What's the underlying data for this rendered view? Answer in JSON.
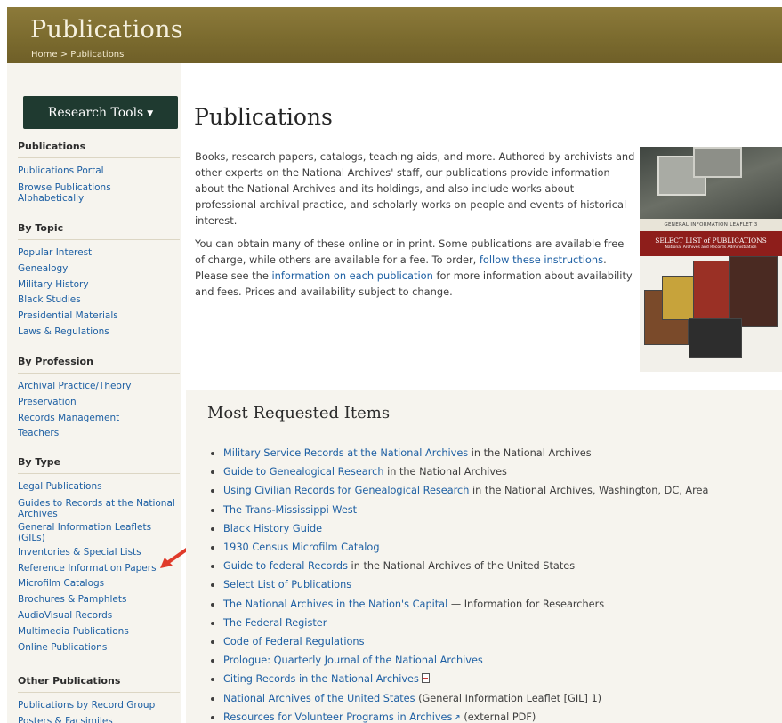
{
  "banner": {
    "title": "Publications",
    "breadcrumb": "Home > Publications"
  },
  "sidebar": {
    "research_tools_label": "Research Tools",
    "sections": {
      "publications": {
        "heading": "Publications",
        "items": [
          "Publications Portal",
          "Browse Publications Alphabetically"
        ]
      },
      "by_topic": {
        "heading": "By Topic",
        "items": [
          "Popular Interest",
          "Genealogy",
          "Military History",
          "Black Studies",
          "Presidential Materials",
          "Laws & Regulations"
        ]
      },
      "by_profession": {
        "heading": "By Profession",
        "items": [
          "Archival Practice/Theory",
          "Preservation",
          "Records Management",
          "Teachers"
        ]
      },
      "by_type": {
        "heading": "By Type",
        "items": [
          "Legal Publications",
          "Guides to Records at the National Archives",
          "General Information Leaflets (GILs)",
          "Inventories & Special Lists",
          "Reference Information Papers",
          "Microfilm Catalogs",
          "Brochures & Pamphlets",
          "AudioVisual Records",
          "Multimedia Publications",
          "Online Publications"
        ]
      },
      "other": {
        "heading": "Other Publications",
        "items": [
          "Publications by Record Group",
          "Posters & Facsimiles"
        ]
      }
    }
  },
  "main": {
    "title": "Publications",
    "intro_p1": "Books, research papers, catalogs, teaching aids, and more. Authored by archivists and other experts on the National Archives' staff, our publications provide information about the National Archives and its holdings, and also include works about professional archival practice, and scholarly works on people and events of historical interest.",
    "intro_p2_a": "You can obtain many of these online or in print. Some publications are available free of charge, while others are available for a fee. To order, ",
    "intro_p2_link1": "follow these instructions",
    "intro_p2_b": ". Please see the ",
    "intro_p2_link2": "information on each publication",
    "intro_p2_c": " for more information about availability and fees. Prices and availability subject to change.",
    "thumb_gil_text": "GENERAL INFORMATION LEAFLET 3",
    "thumb_sel_text": "SELECT LIST of PUBLICATIONS",
    "thumb_sel_sub": "National Archives and Records Administration"
  },
  "most_requested": {
    "title": "Most Requested Items",
    "items": [
      {
        "link": "Military Service Records at the National Archives",
        "rest": " in the National Archives"
      },
      {
        "link": "Guide to Genealogical Research",
        "rest": " in the National Archives"
      },
      {
        "link": "Using Civilian Records for Genealogical Research",
        "rest": " in the National Archives, Washington, DC, Area"
      },
      {
        "link": "The Trans-Mississippi West",
        "rest": ""
      },
      {
        "link": "Black History Guide",
        "rest": ""
      },
      {
        "link": "1930 Census Microfilm Catalog",
        "rest": ""
      },
      {
        "link": "Guide to federal Records",
        "rest": " in the National Archives of the United States"
      },
      {
        "link": "Select List of Publications",
        "rest": ""
      },
      {
        "link": "The National Archives in the Nation's Capital",
        "rest": " — Information for Researchers"
      },
      {
        "link": "The Federal Register",
        "rest": ""
      },
      {
        "link": "Code of Federal Regulations",
        "rest": ""
      },
      {
        "link": "Prologue: Quarterly Journal of the National Archives",
        "rest": ""
      },
      {
        "link": "Citing Records in the National Archives",
        "rest": ""
      },
      {
        "link": "National Archives of the United States",
        "rest": " (General Information Leaflet [GIL] 1)"
      },
      {
        "link": "Resources for Volunteer Programs in Archives",
        "rest": "  (external PDF)"
      }
    ]
  },
  "colors": {
    "banner": "#7a6a2e",
    "link": "#1d5fa3",
    "sidebar_bg": "#f6f4ee",
    "research_button": "#1f3a30",
    "arrow": "#e03a2a"
  },
  "icons": {
    "pdf": "pdf-icon",
    "external": "external-link-icon",
    "caret": "caret-down-icon",
    "arrow": "red-arrow-icon"
  }
}
